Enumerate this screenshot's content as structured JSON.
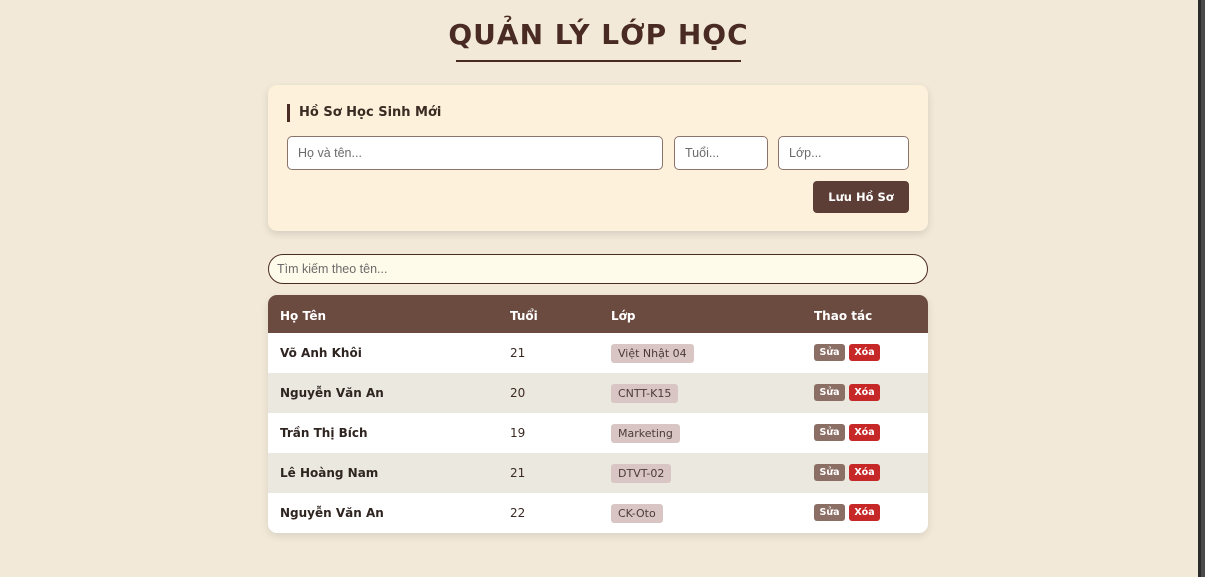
{
  "header": {
    "title": "QUẢN LÝ LỚP HỌC"
  },
  "form": {
    "heading": "Hồ Sơ Học Sinh Mới",
    "name_placeholder": "Họ và tên...",
    "age_placeholder": "Tuổi...",
    "class_placeholder": "Lớp...",
    "save_label": "Lưu Hồ Sơ"
  },
  "search": {
    "placeholder": "Tìm kiếm theo tên..."
  },
  "table": {
    "columns": [
      "Họ Tên",
      "Tuổi",
      "Lớp",
      "Thao tác"
    ],
    "edit_label": "Sửa",
    "delete_label": "Xóa",
    "rows": [
      {
        "name": "Võ Anh Khôi",
        "age": "21",
        "class": "Việt Nhật 04"
      },
      {
        "name": "Nguyễn Văn An",
        "age": "20",
        "class": "CNTT-K15"
      },
      {
        "name": "Trần Thị Bích",
        "age": "19",
        "class": "Marketing"
      },
      {
        "name": "Lê Hoàng Nam",
        "age": "21",
        "class": "DTVT-02"
      },
      {
        "name": "Nguyễn Văn An",
        "age": "22",
        "class": "CK-Oto"
      }
    ]
  },
  "colors": {
    "background": "#f2e9d8",
    "header_row": "#6b4a40",
    "save_button": "#5c3e36",
    "delete_button": "#c62828",
    "edit_button": "#8b6e64"
  }
}
